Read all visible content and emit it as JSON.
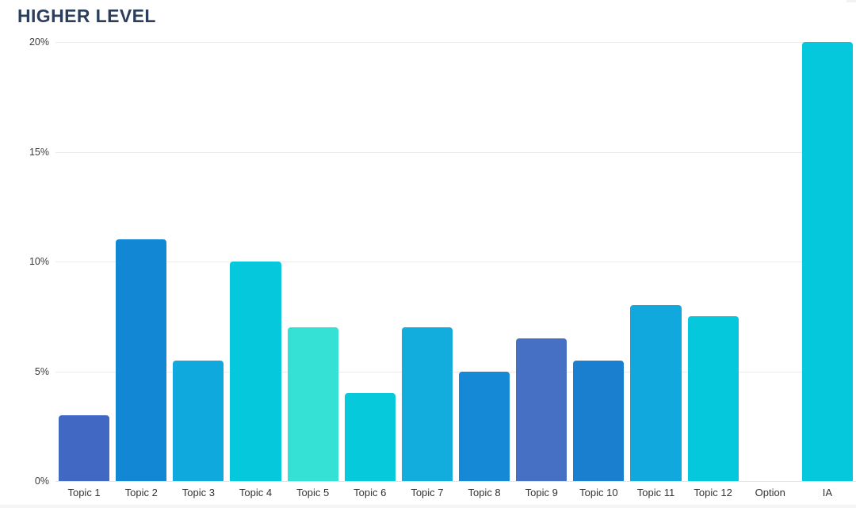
{
  "chart_data": {
    "type": "bar",
    "title": "HIGHER LEVEL",
    "xlabel": "",
    "ylabel": "",
    "ylim": [
      0,
      20
    ],
    "ytick_labels": [
      "0%",
      "5%",
      "10%",
      "15%",
      "20%"
    ],
    "ytick_values": [
      0,
      5,
      10,
      15,
      20
    ],
    "grid": true,
    "legend": "none",
    "categories": [
      "Topic 1",
      "Topic 2",
      "Topic 3",
      "Topic 4",
      "Topic 5",
      "Topic 6",
      "Topic 7",
      "Topic 8",
      "Topic 9",
      "Topic 10",
      "Topic 11",
      "Topic 12",
      "Option",
      "IA"
    ],
    "values": [
      3,
      11,
      5.5,
      10,
      7,
      4,
      7,
      5,
      6.5,
      5.5,
      8,
      7.5,
      0,
      20
    ],
    "bar_colors": [
      "#4169c4",
      "#1288d4",
      "#10a9dd",
      "#05c8dc",
      "#35e0d5",
      "#06c9dc",
      "#12acdd",
      "#1589d5",
      "#4570c4",
      "#1b7fd0",
      "#11a8dd",
      "#05c8dc",
      "#ffffff",
      "#05c8dc"
    ]
  },
  "style": {
    "title_color": "#2b3f5c",
    "gridline_color": "#ebebeb",
    "axis_text_color": "#333333",
    "background": "#ffffff"
  }
}
